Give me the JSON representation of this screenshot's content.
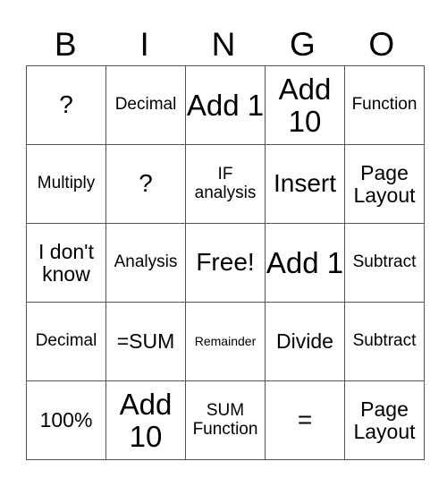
{
  "header": {
    "letters": [
      "B",
      "I",
      "N",
      "G",
      "O"
    ]
  },
  "board": {
    "rows": [
      [
        {
          "text": "?",
          "size": "lg"
        },
        {
          "text": "Decimal",
          "size": "sm"
        },
        {
          "text": "Add 1",
          "size": "xl"
        },
        {
          "text": "Add 10",
          "size": "xl"
        },
        {
          "text": "Function",
          "size": "sm"
        }
      ],
      [
        {
          "text": "Multiply",
          "size": "sm"
        },
        {
          "text": "?",
          "size": "lg"
        },
        {
          "text": "IF analysis",
          "size": "sm"
        },
        {
          "text": "Insert",
          "size": "lg"
        },
        {
          "text": "Page Layout",
          "size": "md"
        }
      ],
      [
        {
          "text": "I don't know",
          "size": "md"
        },
        {
          "text": "Analysis",
          "size": "sm"
        },
        {
          "text": "Free!",
          "size": "lg"
        },
        {
          "text": "Add 1",
          "size": "xl"
        },
        {
          "text": "Subtract",
          "size": "sm"
        }
      ],
      [
        {
          "text": "Decimal",
          "size": "sm"
        },
        {
          "text": "=SUM",
          "size": "md"
        },
        {
          "text": "Remainder",
          "size": "xs"
        },
        {
          "text": "Divide",
          "size": "md"
        },
        {
          "text": "Subtract",
          "size": "sm"
        }
      ],
      [
        {
          "text": "100%",
          "size": "md"
        },
        {
          "text": "Add 10",
          "size": "xl"
        },
        {
          "text": "SUM Function",
          "size": "sm"
        },
        {
          "text": "=",
          "size": "lg"
        },
        {
          "text": "Page Layout",
          "size": "md"
        }
      ]
    ]
  }
}
